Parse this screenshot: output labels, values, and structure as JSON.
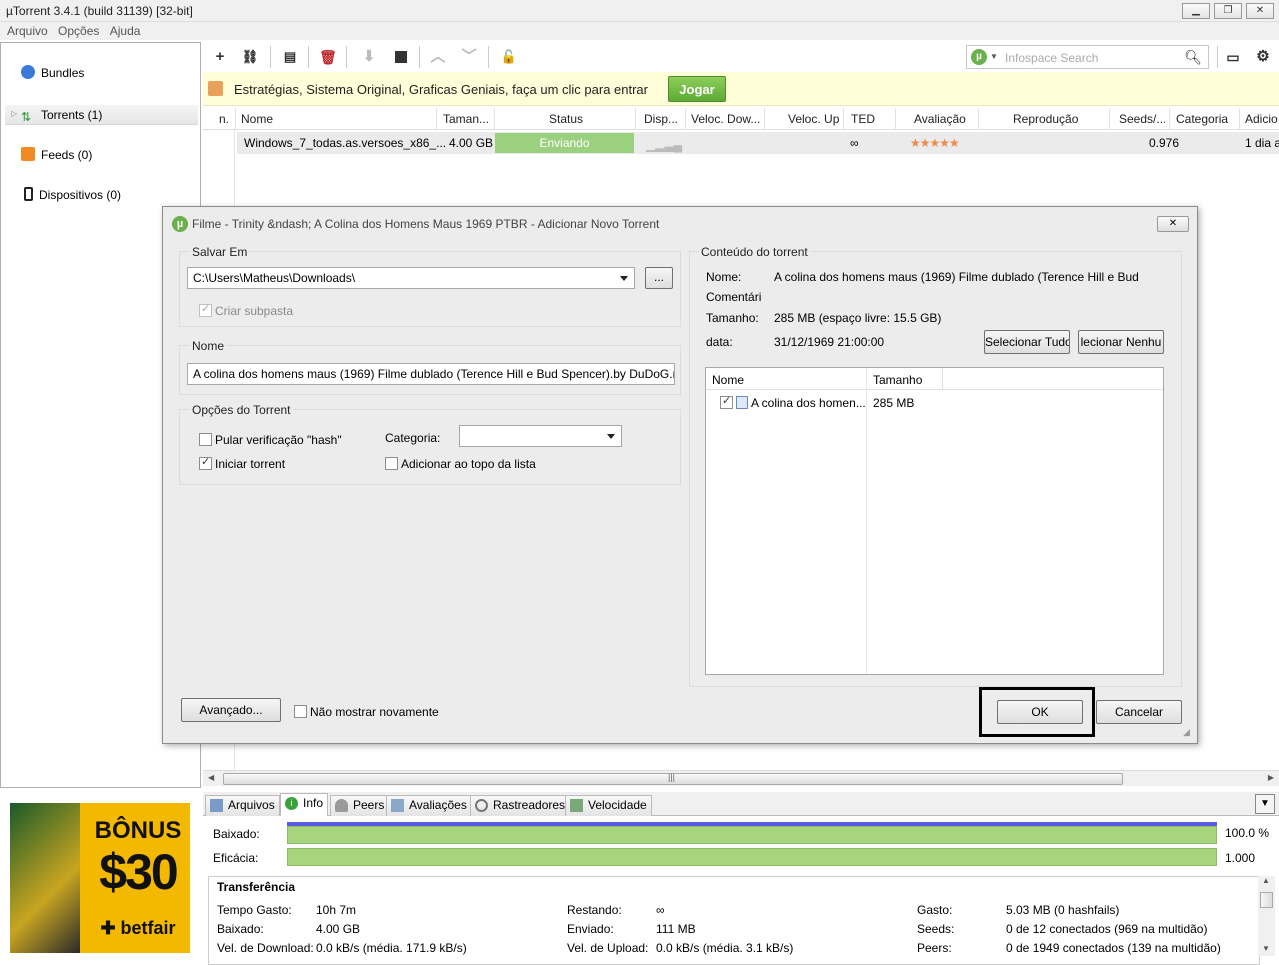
{
  "window": {
    "title": "µTorrent 3.4.1  (build 31139) [32-bit]"
  },
  "menu": [
    "Arquivo",
    "Opções",
    "Ajuda"
  ],
  "sidebar": {
    "items": [
      {
        "label": "Bundles"
      },
      {
        "label": "Torrents (1)"
      },
      {
        "label": "Feeds (0)"
      },
      {
        "label": "Dispositivos (0)"
      }
    ]
  },
  "ad": {
    "bonus": "BÔNUS",
    "amount": "$30",
    "brand": "betfair"
  },
  "search": {
    "placeholder": "Infospace Search"
  },
  "promo": {
    "text": "Estratégias, Sistema Original, Graficas Geniais, faça um clic para entrar",
    "button": "Jogar"
  },
  "columns": [
    "n.",
    "Nome",
    "Taman...",
    "Status",
    "Disp...",
    "Veloc. Dow...",
    "Veloc. Up",
    "TED",
    "Avaliação",
    "Reprodução",
    "Seeds/...",
    "Categoria",
    "Adicio"
  ],
  "torrent": {
    "name": "Windows_7_todas.as.versoes_x86_...",
    "size": "4.00 GB",
    "status": "Enviando",
    "ted": "∞",
    "rating": "★★★★★",
    "seeds": "0.976",
    "added": "1 dia a"
  },
  "tabs": [
    "Arquivos",
    "Info",
    "Peers",
    "Avaliações",
    "Rastreadores",
    "Velocidade"
  ],
  "info": {
    "downloaded_label": "Baixado:",
    "downloaded_value": "100.0 %",
    "downloaded_fraction": 1.0,
    "efficiency_label": "Eficácia:",
    "efficiency_value": "1.000",
    "transfer_title": "Transferência",
    "rows": [
      {
        "k": "Tempo Gasto:",
        "v": "10h 7m"
      },
      {
        "k": "Baixado:",
        "v": "4.00 GB"
      },
      {
        "k": "Vel. de Download:",
        "v": "0.0 kB/s (média. 171.9 kB/s)"
      },
      {
        "k": "Restando:",
        "v": "∞"
      },
      {
        "k": "Enviado:",
        "v": "111 MB"
      },
      {
        "k": "Vel. de Upload:",
        "v": "0.0 kB/s (média. 3.1 kB/s)"
      },
      {
        "k": "Gasto:",
        "v": "5.03 MB (0 hashfails)"
      },
      {
        "k": "Seeds:",
        "v": "0 de 12 conectados (969 na multidão)"
      },
      {
        "k": "Peers:",
        "v": "0 de 1949 conectados (139 na multidão)"
      }
    ]
  },
  "dialog": {
    "title": "Filme - Trinity &ndash; A Colina dos Homens Maus 1969 PTBR - Adicionar Novo Torrent",
    "save_group": "Salvar Em",
    "save_path": "C:\\Users\\Matheus\\Downloads\\",
    "browse": "...",
    "subfolder": "Criar subpasta",
    "name_group": "Nome",
    "name_value": "A colina dos homens maus (1969) Filme dublado (Terence Hill e Bud Spencer).by DuDoG.m",
    "options_group": "Opções do Torrent",
    "skip_hash": "Pular verificação \"hash\"",
    "start_torrent": "Iniciar torrent",
    "category_label": "Categoria:",
    "add_top": "Adicionar ao topo da lista",
    "content_group": "Conteúdo do torrent",
    "name_label": "Nome:",
    "content_name": "A colina dos homens maus (1969) Filme dublado (Terence Hill e Bud",
    "comment_label": "Comentári",
    "size_label": "Tamanho:",
    "size_value": "285 MB (espaço livre: 15.5 GB)",
    "date_label": "data:",
    "date_value": "31/12/1969 21:00:00",
    "select_all": "Selecionar Tudo",
    "select_none": "lecionar Nenhu",
    "col_name": "Nome",
    "col_size": "Tamanho",
    "file_name": "A colina dos homen...",
    "file_size": "285 MB",
    "advanced": "Avançado...",
    "dont_show": "Não mostrar novamente",
    "ok": "OK",
    "cancel": "Cancelar"
  }
}
